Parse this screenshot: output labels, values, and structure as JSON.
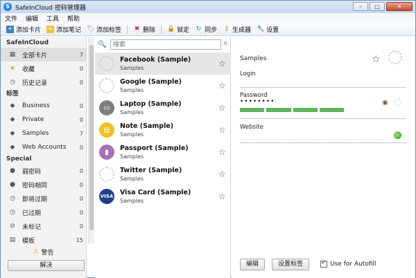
{
  "window": {
    "title": "SafeInCloud 密码管理器",
    "controls": [
      "–",
      "□",
      "✕"
    ]
  },
  "menu": [
    "文件",
    "编辑",
    "工具",
    "帮助"
  ],
  "toolbar": {
    "add_card": "添加卡片",
    "add_note": "添加笔记",
    "add_label": "添加标签",
    "delete": "删除",
    "lock": "锁定",
    "sync": "同步",
    "generator": "生成器",
    "settings": "设置"
  },
  "sidebar": {
    "section_main": "SafeInCloud",
    "main_items": [
      {
        "label": "全部卡片",
        "count": "7",
        "icon": "grid-icon"
      },
      {
        "label": "收藏",
        "count": "0",
        "icon": "star-icon"
      },
      {
        "label": "历史记录",
        "count": "0",
        "icon": "clock-icon"
      }
    ],
    "section_labels": "标签",
    "label_items": [
      {
        "label": "Business",
        "count": "0"
      },
      {
        "label": "Private",
        "count": "0"
      },
      {
        "label": "Samples",
        "count": "7"
      },
      {
        "label": "Web Accounts",
        "count": "0"
      }
    ],
    "section_special": "Special",
    "special_items": [
      {
        "label": "弱密码",
        "count": "0"
      },
      {
        "label": "密码相同",
        "count": "0"
      },
      {
        "label": "即将过期",
        "count": "0"
      },
      {
        "label": "已过期",
        "count": "0"
      },
      {
        "label": "未标记",
        "count": "0"
      },
      {
        "label": "模板",
        "count": "15"
      }
    ],
    "warning": "警告",
    "resolve_button": "解决"
  },
  "search": {
    "placeholder": "搜索",
    "value": "搜索"
  },
  "cards": [
    {
      "title": "Facebook (Sample)",
      "label": "Samples",
      "icon": "empty"
    },
    {
      "title": "Google (Sample)",
      "label": "Samples",
      "icon": "empty"
    },
    {
      "title": "Laptop (Sample)",
      "label": "Samples",
      "icon": "laptop",
      "color": "#7f7f7f"
    },
    {
      "title": "Note (Sample)",
      "label": "Samples",
      "icon": "note",
      "color": "#f0c020"
    },
    {
      "title": "Passport (Sample)",
      "label": "Samples",
      "icon": "passport",
      "color": "#a472b8"
    },
    {
      "title": "Twitter (Sample)",
      "label": "Samples",
      "icon": "empty"
    },
    {
      "title": "Visa Card (Sample)",
      "label": "Samples",
      "icon": "visa",
      "color": "#1f3f8a"
    }
  ],
  "detail": {
    "name": "Samples",
    "login_label": "Login",
    "password_label": "Password",
    "password_value": "••••••••",
    "website_label": "Website",
    "edit_button": "编辑",
    "set_labels_button": "设置标签",
    "autofill_label": "Use for Autofill",
    "autofill_checked": true
  }
}
